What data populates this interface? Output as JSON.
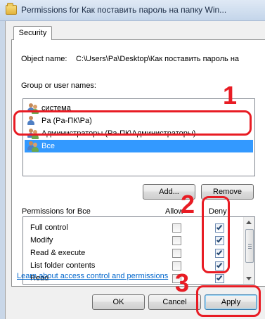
{
  "window": {
    "title": "Permissions for Как поставить пароль на папку Win..."
  },
  "tabs": [
    {
      "label": "Security"
    }
  ],
  "object": {
    "label": "Object name:",
    "value": "C:\\Users\\Pa\\Desktop\\Как поставить пароль на"
  },
  "users": {
    "label": "Group or user names:",
    "items": [
      {
        "name": "система"
      },
      {
        "name": "Pa (Pa-ПК\\Pa)"
      },
      {
        "name": "Администраторы (Pa-ПК\\Администраторы)"
      },
      {
        "name": "Все",
        "selected": true
      }
    ]
  },
  "buttons": {
    "add": "Add...",
    "remove": "Remove",
    "ok": "OK",
    "cancel": "Cancel",
    "apply": "Apply"
  },
  "permissions": {
    "label": "Permissions for Все",
    "allow_header": "Allow",
    "deny_header": "Deny",
    "rows": [
      {
        "name": "Full control",
        "allow": false,
        "deny": true
      },
      {
        "name": "Modify",
        "allow": false,
        "deny": true
      },
      {
        "name": "Read & execute",
        "allow": false,
        "deny": true
      },
      {
        "name": "List folder contents",
        "allow": false,
        "deny": true
      },
      {
        "name": "Read",
        "allow": false,
        "deny": true
      }
    ]
  },
  "link": {
    "text": "Learn about access control and permissions"
  },
  "annotations": [
    "1",
    "2",
    "3"
  ],
  "colors": {
    "annotation": "#e81c24",
    "selection": "#3399ff",
    "link": "#0066cc"
  },
  "icons": [
    "folder-icon",
    "user-group-icon",
    "checkbox-check-icon",
    "scroll-up-icon",
    "scroll-down-icon"
  ]
}
